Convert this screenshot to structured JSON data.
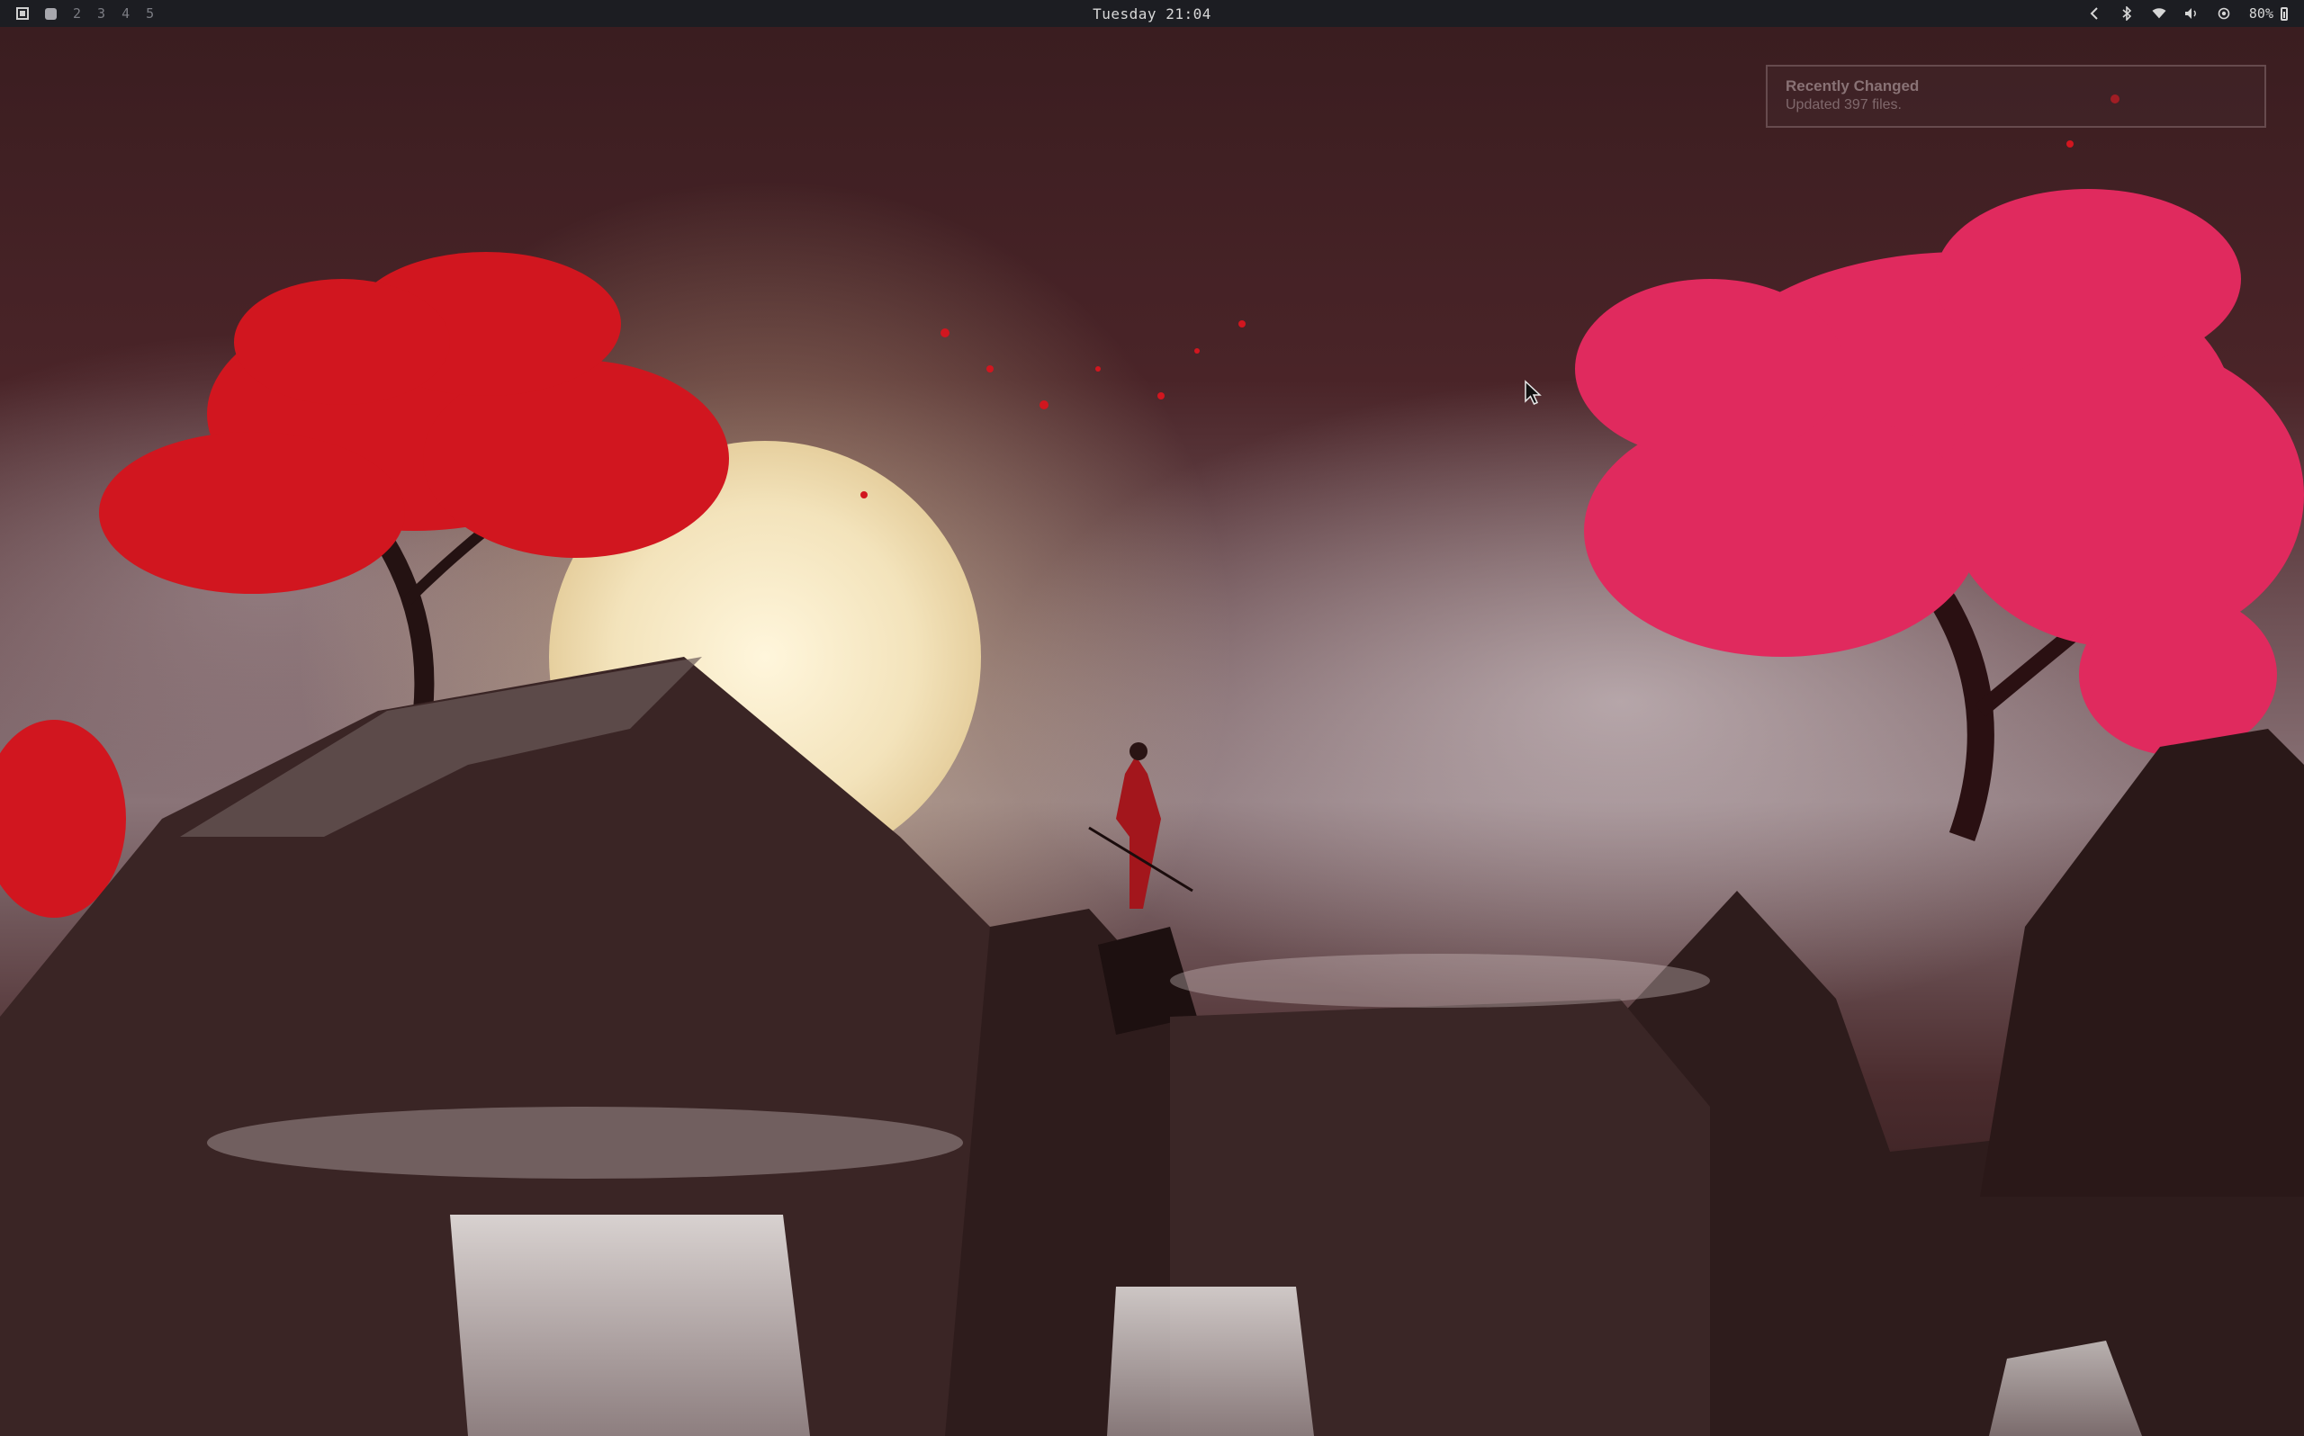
{
  "topbar": {
    "workspaces": [
      "2",
      "3",
      "4",
      "5"
    ],
    "clock": "Tuesday 21:04",
    "battery": "80%"
  },
  "notification": {
    "title": "Recently Changed",
    "body": "Updated 397 files."
  },
  "colors": {
    "bar_bg": "#1c1d22",
    "bar_text": "#d6d6d6",
    "workspace_inactive": "#7b7c83",
    "workspace_active": "#a7a7ad",
    "notification_border": "#785c60"
  }
}
